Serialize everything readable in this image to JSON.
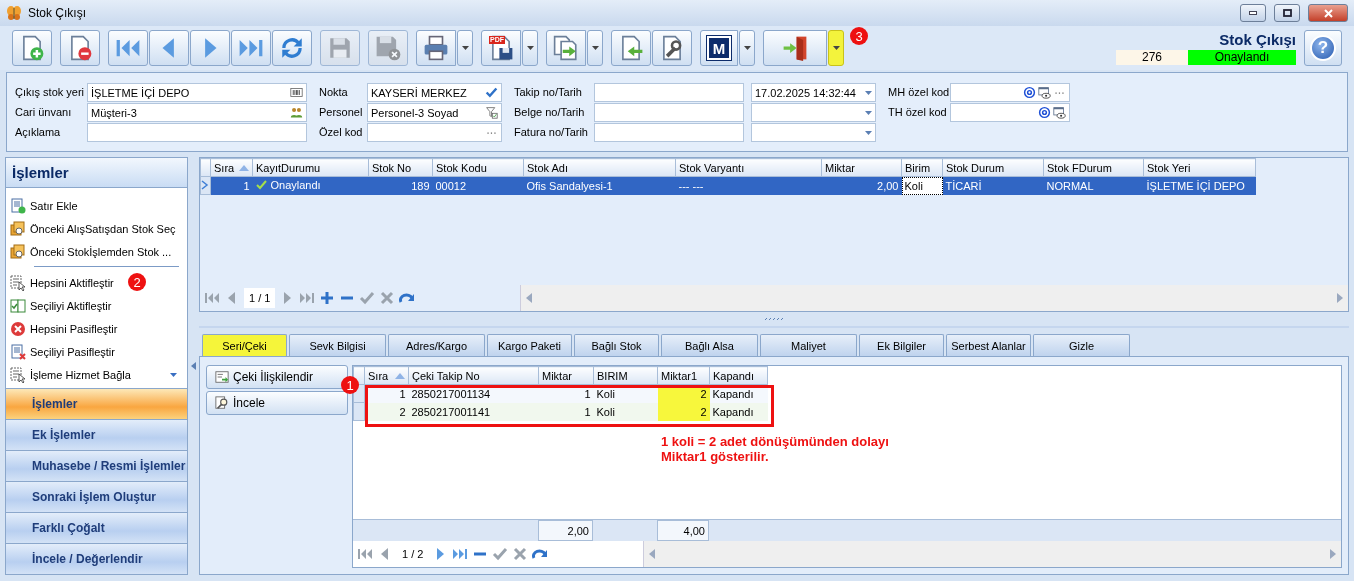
{
  "window": {
    "title": "Stok Çıkışı",
    "controls": [
      {
        "kind": "minimize"
      },
      {
        "kind": "restore"
      },
      {
        "kind": "close"
      }
    ]
  },
  "toolbar": {
    "groups": [
      [
        {
          "kind": "new",
          "disabled": false,
          "dropdown": false
        }
      ],
      [
        {
          "kind": "delete",
          "disabled": false,
          "dropdown": false
        }
      ],
      [
        {
          "kind": "first",
          "disabled": false,
          "dropdown": false
        },
        {
          "kind": "prev",
          "disabled": false,
          "dropdown": false
        },
        {
          "kind": "next",
          "disabled": false,
          "dropdown": false
        },
        {
          "kind": "last",
          "disabled": false,
          "dropdown": false
        },
        {
          "kind": "refresh",
          "disabled": false,
          "dropdown": false
        }
      ],
      [
        {
          "kind": "save",
          "disabled": true,
          "dropdown": false
        }
      ],
      [
        {
          "kind": "save-cancel",
          "disabled": true,
          "dropdown": false
        }
      ],
      [
        {
          "kind": "print",
          "disabled": false,
          "dropdown": true
        }
      ],
      [
        {
          "kind": "pdf",
          "label": "PDF",
          "disabled": false,
          "dropdown": true
        }
      ],
      [
        {
          "kind": "export",
          "disabled": false,
          "dropdown": true
        }
      ],
      [
        {
          "kind": "import",
          "disabled": false,
          "dropdown": false
        },
        {
          "kind": "settings",
          "disabled": false,
          "dropdown": false
        }
      ],
      [
        {
          "kind": "module",
          "label": "M",
          "disabled": false,
          "dropdown": true
        }
      ],
      [
        {
          "kind": "exit",
          "disabled": false,
          "dropdown": true,
          "dropdown_highlighted": true,
          "badge": "3"
        }
      ]
    ]
  },
  "header": {
    "title": "Stok Çıkışı",
    "number": "276",
    "status": "Onaylandı",
    "help": "?"
  },
  "form": {
    "columns": [
      [
        {
          "label": "Çıkış stok yeri",
          "inputs": [
            {
              "kind": "text",
              "value": "İŞLETME İÇİ DEPO",
              "adorns": [
                {
                  "kind": "barcode"
                }
              ]
            }
          ]
        },
        {
          "label": "Cari ünvanı",
          "inputs": [
            {
              "kind": "text",
              "value": "Müşteri-3",
              "adorns": [
                {
                  "kind": "people"
                }
              ]
            }
          ]
        },
        {
          "label": "Açıklama",
          "inputs": [
            {
              "kind": "text"
            }
          ]
        }
      ],
      [
        {
          "label": "Nokta",
          "inputs": [
            {
              "kind": "text",
              "value": "KAYSERİ MERKEZ",
              "adorns": [
                {
                  "kind": "check"
                }
              ]
            }
          ]
        },
        {
          "label": "Personel",
          "inputs": [
            {
              "kind": "text",
              "value": "Personel-3 Soyad",
              "adorns": [
                {
                  "kind": "filter"
                }
              ]
            }
          ]
        },
        {
          "label": "Özel kod",
          "inputs": [
            {
              "kind": "text",
              "adorns": [
                {
                  "kind": "more"
                }
              ]
            }
          ]
        }
      ],
      [
        {
          "label": "Takip no/Tarih",
          "inputs": [
            {
              "kind": "text"
            },
            {
              "kind": "combo",
              "value": "17.02.2025 14:32:44"
            }
          ]
        },
        {
          "label": "Belge no/Tarih",
          "inputs": [
            {
              "kind": "text"
            },
            {
              "kind": "combo"
            }
          ]
        },
        {
          "label": "Fatura no/Tarih",
          "inputs": [
            {
              "kind": "text"
            },
            {
              "kind": "combo"
            }
          ]
        }
      ],
      [
        {
          "label": "MH özel kod",
          "inputs": [
            {
              "kind": "text",
              "adorns": [
                {
                  "kind": "at"
                },
                {
                  "kind": "view"
                },
                {
                  "kind": "more"
                }
              ]
            }
          ]
        },
        {
          "label": "TH özel kod",
          "inputs": [
            {
              "kind": "text",
              "adorns": [
                {
                  "kind": "at"
                },
                {
                  "kind": "view"
                }
              ]
            }
          ]
        }
      ]
    ]
  },
  "sidebar": {
    "title": "İşlemler",
    "sections": [
      [
        {
          "label": "Satır Ekle",
          "kind": "add-row",
          "menu": false
        },
        {
          "label": "Önceki AlışSatışdan Stok Seç",
          "kind": "pick",
          "menu": false
        },
        {
          "label": "Önceki Stokİşlemden Stok ...",
          "kind": "pick",
          "menu": false
        }
      ],
      [
        {
          "label": "Hepsini Aktifleştir",
          "kind": "select-all",
          "menu": false,
          "badge": "2"
        },
        {
          "label": "Seçiliyi Aktifleştir",
          "kind": "activate",
          "menu": false
        },
        {
          "label": "Hepsini Pasifleştir",
          "kind": "remove-all",
          "menu": false
        },
        {
          "label": "Seçiliyi Pasifleştir",
          "kind": "deactivate",
          "menu": false
        },
        {
          "label": "İşleme Hizmet Bağla",
          "kind": "select-all",
          "menu": true
        }
      ]
    ],
    "groups": [
      {
        "label": "İşlemler",
        "selected": true
      },
      {
        "label": "Ek İşlemler",
        "selected": false
      },
      {
        "label": "Muhasebe / Resmi İşlemler",
        "selected": false
      },
      {
        "label": "Sonraki İşlem Oluştur",
        "selected": false
      },
      {
        "label": "Farklı Çoğalt",
        "selected": false
      },
      {
        "label": "İncele / Değerlendir",
        "selected": false
      }
    ]
  },
  "grid": {
    "columns": [
      {
        "label": "Sıra",
        "sorted": true,
        "numeric": true
      },
      {
        "label": "KayıtDurumu",
        "sorted": false,
        "numeric": false
      },
      {
        "label": "Stok No",
        "sorted": false,
        "numeric": true
      },
      {
        "label": "Stok Kodu",
        "sorted": false,
        "numeric": false
      },
      {
        "label": "Stok Adı",
        "sorted": false,
        "numeric": false
      },
      {
        "label": "Stok Varyantı",
        "sorted": false,
        "numeric": false
      },
      {
        "label": "Miktar",
        "sorted": false,
        "numeric": true
      },
      {
        "label": "Birim",
        "sorted": false,
        "numeric": false
      },
      {
        "label": "Stok Durum",
        "sorted": false,
        "numeric": false
      },
      {
        "label": "Stok FDurum",
        "sorted": false,
        "numeric": false
      },
      {
        "label": "Stok Yeri",
        "sorted": false,
        "numeric": false
      }
    ],
    "rows": [
      {
        "selected": true,
        "approved": true,
        "cells": [
          {
            "text": "1",
            "focused": false
          },
          {
            "text": "Onaylandı",
            "focused": false
          },
          {
            "text": "189",
            "focused": false
          },
          {
            "text": "00012",
            "focused": false
          },
          {
            "text": "Ofis Sandalyesi-1",
            "focused": false
          },
          {
            "text": "--- ---",
            "focused": false
          },
          {
            "text": "2,00",
            "focused": false
          },
          {
            "text": "Koli",
            "focused": true
          },
          {
            "text": "TİCARİ",
            "focused": false
          },
          {
            "text": "NORMAL",
            "focused": false
          },
          {
            "text": "İŞLETME İÇİ DEPO",
            "focused": false
          }
        ]
      }
    ],
    "pager": {
      "page": "1 / 1",
      "before": [
        {
          "kind": "first",
          "disabled": true
        },
        {
          "kind": "prev",
          "disabled": true
        }
      ],
      "after": [
        {
          "kind": "next",
          "disabled": true
        },
        {
          "kind": "last",
          "disabled": true
        },
        {
          "kind": "plus",
          "disabled": false
        },
        {
          "kind": "minus",
          "disabled": false
        },
        {
          "kind": "check",
          "disabled": true
        },
        {
          "kind": "cross",
          "disabled": true
        },
        {
          "kind": "redo",
          "disabled": false
        }
      ]
    }
  },
  "tabs": [
    {
      "label": "Seri/Çeki",
      "selected": true
    },
    {
      "label": "Sevk Bilgisi",
      "selected": false
    },
    {
      "label": "Adres/Kargo",
      "selected": false
    },
    {
      "label": "Kargo Paketi",
      "selected": false
    },
    {
      "label": "Bağlı Stok",
      "selected": false
    },
    {
      "label": "Bağlı Alsa",
      "selected": false
    },
    {
      "label": "Maliyet",
      "selected": false
    },
    {
      "label": "Ek Bilgiler",
      "selected": false
    },
    {
      "label": "Serbest Alanlar",
      "selected": false
    },
    {
      "label": "Gizle",
      "selected": false
    }
  ],
  "detail": {
    "buttons": [
      {
        "label": "Çeki İlişkilendir",
        "kind": "link"
      },
      {
        "label": "İncele",
        "kind": "inspect"
      }
    ],
    "badge": "1",
    "note": [
      "1 koli = 2 adet dönüşümünden dolayı",
      "Miktar1 gösterilir."
    ],
    "grid": {
      "columns": [
        {
          "label": "Sıra",
          "sorted": true,
          "numeric": true,
          "highlighted": false
        },
        {
          "label": "Çeki Takip No",
          "sorted": false,
          "numeric": false,
          "highlighted": false
        },
        {
          "label": "Miktar",
          "sorted": false,
          "numeric": true,
          "highlighted": false,
          "total": "2,00"
        },
        {
          "label": "BIRIM",
          "sorted": false,
          "numeric": false,
          "highlighted": false
        },
        {
          "label": "Miktar1",
          "sorted": false,
          "numeric": true,
          "highlighted": true,
          "total": "4,00"
        },
        {
          "label": "Kapandı",
          "sorted": false,
          "numeric": false,
          "highlighted": false
        }
      ],
      "rows": [
        [
          "1",
          "2850217001134",
          "1",
          "Koli",
          "2",
          "Kapandı"
        ],
        [
          "2",
          "2850217001141",
          "1",
          "Koli",
          "2",
          "Kapandı"
        ]
      ],
      "pager": {
        "page": "1 / 2",
        "before": [
          {
            "kind": "first",
            "disabled": true
          },
          {
            "kind": "prev",
            "disabled": true
          }
        ],
        "after": [
          {
            "kind": "next",
            "disabled": false
          },
          {
            "kind": "last",
            "disabled": false
          },
          {
            "kind": "minus",
            "disabled": false
          },
          {
            "kind": "check",
            "disabled": true
          },
          {
            "kind": "cross",
            "disabled": true
          },
          {
            "kind": "redo",
            "disabled": false
          }
        ]
      }
    }
  }
}
